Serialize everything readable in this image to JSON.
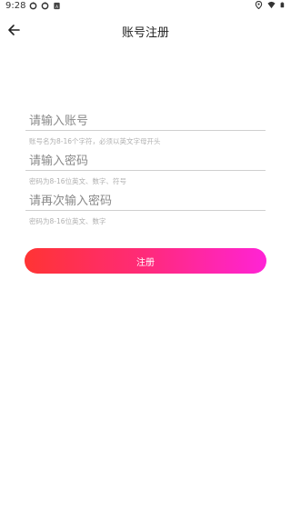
{
  "status_bar": {
    "time": "9:28",
    "icons": [
      "sync-icon",
      "sync-icon",
      "sim-icon",
      "location-icon",
      "wifi-icon",
      "battery-icon"
    ]
  },
  "header": {
    "title": "账号注册",
    "back_icon": "arrow-left-icon"
  },
  "form": {
    "account": {
      "placeholder": "请输入账号",
      "value": "",
      "hint": "账号名为8-16个字符，必须以英文字母开头"
    },
    "password": {
      "placeholder": "请输入密码",
      "value": "",
      "hint": "密码为8-16位英文、数字、符号"
    },
    "confirm_password": {
      "placeholder": "请再次输入密码",
      "value": "",
      "hint": "密码为8-16位英文、数字"
    }
  },
  "register_button": {
    "label": "注册",
    "gradient_colors": [
      "#ff3434",
      "#ff2a7a",
      "#ff23d6"
    ]
  }
}
